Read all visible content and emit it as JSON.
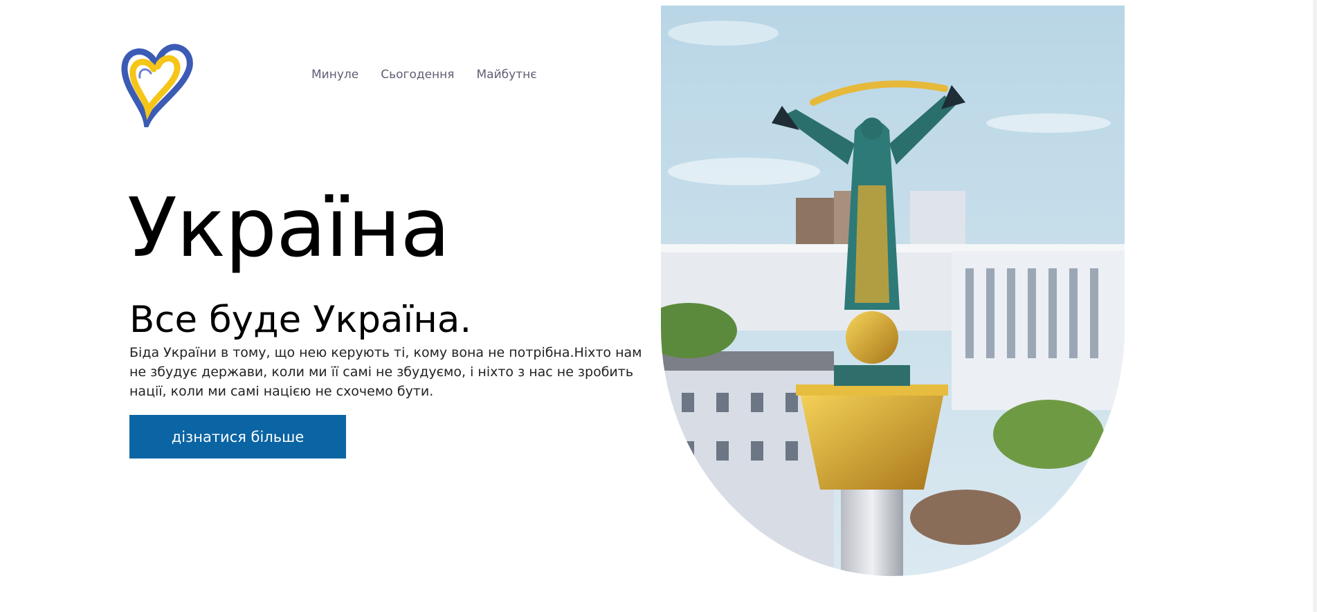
{
  "nav": {
    "items": [
      "Минуле",
      "Сьогодення",
      "Майбутнє"
    ]
  },
  "hero": {
    "title": "Україна",
    "subtitle": "Все буде Україна.",
    "body": "Біда України в тому, що нею керують ті, кому вона не потрібна.Ніхто нам не збудує держави, коли ми її самі не збудуємо, і ніхто з нас не зробить нації, коли ми самі нацією не схочемо бути.",
    "button_label": "дізнатися більше"
  },
  "colors": {
    "accent": "#0b64a3",
    "logo_blue": "#3b5bb5",
    "logo_yellow": "#f5c518"
  },
  "icons": {
    "logo": "heart-logo-icon"
  }
}
